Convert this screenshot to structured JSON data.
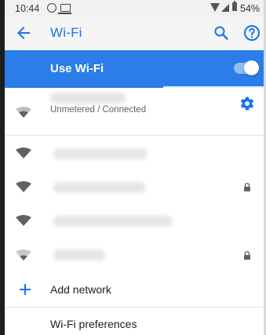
{
  "status_bar": {
    "time": "10:44",
    "battery": "54%",
    "icons": [
      "whatsapp-icon",
      "laptop-icon",
      "wifi-signal-icon",
      "cell-signal-icon",
      "battery-icon"
    ]
  },
  "toolbar": {
    "title": "Wi-Fi",
    "back_icon": "arrow-left",
    "search_icon": "search",
    "help_icon": "question-circle",
    "accent": "#1a73e8"
  },
  "use_wifi": {
    "label": "Use Wi-Fi",
    "enabled": true,
    "background": "#2b7de9"
  },
  "connected_network": {
    "status": "Unmetered / Connected",
    "name_hidden": true,
    "settings_icon": "gear"
  },
  "networks": [
    {
      "name_hidden": true,
      "locked": false,
      "signal": "full"
    },
    {
      "name_hidden": true,
      "locked": true,
      "signal": "full"
    },
    {
      "name_hidden": true,
      "locked": false,
      "signal": "full"
    },
    {
      "name_hidden": true,
      "locked": true,
      "signal": "weak"
    }
  ],
  "actions": {
    "add_network": "Add network",
    "preferences": "Wi-Fi preferences"
  }
}
